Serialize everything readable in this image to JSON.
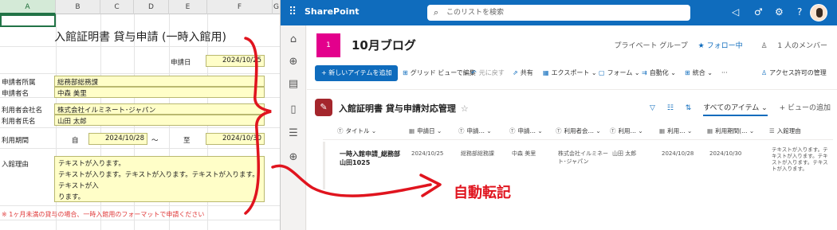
{
  "excel": {
    "columns": [
      "A",
      "B",
      "C",
      "D",
      "E",
      "F",
      "G"
    ],
    "form_title": "入館証明書 貸与申請 (一時入館用)",
    "apply_date_label": "申請日",
    "apply_date": "2024/10/25",
    "dept_label": "申請者所属",
    "dept_value": "総務部総務課",
    "name_label": "申請者名",
    "name_value": "中森 美里",
    "company_label": "利用者会社名",
    "company_value": "株式会社イルミネート･ジャパン",
    "user_label": "利用者氏名",
    "user_value": "山田 太郎",
    "period_label": "利用期間",
    "from_label": "自",
    "from_date": "2024/10/28",
    "tilde": "～",
    "to_label": "至",
    "to_date": "2024/10/30",
    "reason_label": "入館理由",
    "reason_line1": "テキストが入ります。",
    "reason_line2": "テキストが入ります。テキストが入ります。テキストが入ります。テキストが入",
    "reason_line3": "ります。",
    "note": "※ 1ヶ月未満の貸与の場合、一時入館用のフォーマットで申請ください"
  },
  "sharepoint": {
    "brand": "SharePoint",
    "search_placeholder": "このリストを検索",
    "site_logo": "1",
    "site_name": "10月ブログ",
    "group_type": "プライベート グループ",
    "follow": "★ フォロー中",
    "members": "1 人のメンバー",
    "commands": {
      "new_item": "+ 新しいアイテムを追加",
      "grid_edit": "グリッド ビューで編集",
      "undo": "元に戻す",
      "share": "共有",
      "export": "エクスポート",
      "form": "フォーム",
      "automate": "自動化",
      "integrate": "統合",
      "more": "···",
      "access": "アクセス許可の管理"
    },
    "list_title": "入館証明書 貸与申請対応管理",
    "all_items": "すべてのアイテム",
    "add_view": "+ ビューの追加",
    "columns": [
      "タイトル",
      "申請日",
      "申請…",
      "申請…",
      "利用者会…",
      "利用…",
      "利用…",
      "利用期間(…",
      "入館理由"
    ],
    "row": {
      "title": "一時入館申請_総務部山田1025",
      "date": "2024/10/25",
      "dept": "総務部総務課",
      "name": "中森 美里",
      "company": "株式会社イルミネート･ジャパン",
      "user": "山田 太郎",
      "from": "2024/10/28",
      "to": "2024/10/30",
      "reason": "テキストが入ります。テキストが入ります。テキストが入ります。テキストが入ります。"
    }
  },
  "annotation": {
    "label": "自動転記",
    "color": "#e0141e"
  }
}
